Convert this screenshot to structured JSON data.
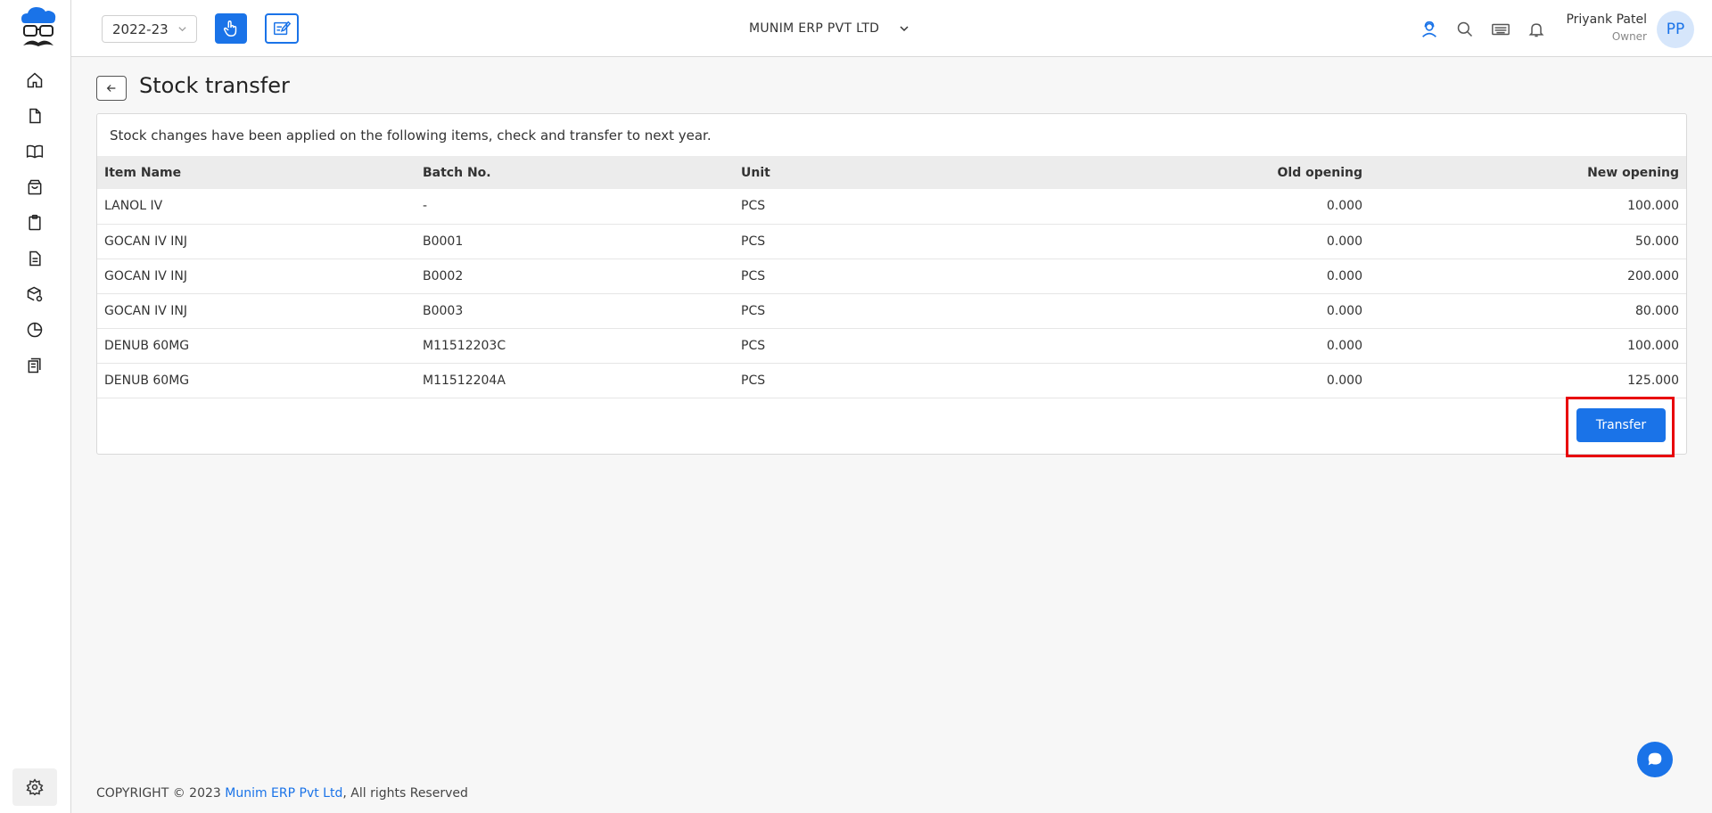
{
  "header": {
    "financial_year": "2022-23",
    "company": "MUNIM ERP PVT LTD",
    "user_name": "Priyank Patel",
    "user_role": "Owner",
    "avatar_initials": "PP"
  },
  "sidebar": {
    "items": [
      {
        "icon": "home-icon"
      },
      {
        "icon": "document-icon"
      },
      {
        "icon": "book-icon"
      },
      {
        "icon": "shopping-bag-icon"
      },
      {
        "icon": "clipboard-icon"
      },
      {
        "icon": "invoice-icon"
      },
      {
        "icon": "box-settings-icon"
      },
      {
        "icon": "pie-chart-icon"
      },
      {
        "icon": "ledger-icon"
      }
    ],
    "settings_icon": "gear-icon"
  },
  "page": {
    "title": "Stock transfer",
    "message": "Stock changes have been applied on the following items, check and transfer to next year."
  },
  "table": {
    "headers": [
      "Item Name",
      "Batch No.",
      "Unit",
      "Old opening",
      "New opening"
    ],
    "rows": [
      [
        "LANOL IV",
        "-",
        "PCS",
        "0.000",
        "100.000"
      ],
      [
        "GOCAN IV INJ",
        "B0001",
        "PCS",
        "0.000",
        "50.000"
      ],
      [
        "GOCAN IV INJ",
        "B0002",
        "PCS",
        "0.000",
        "200.000"
      ],
      [
        "GOCAN IV INJ",
        "B0003",
        "PCS",
        "0.000",
        "80.000"
      ],
      [
        "DENUB 60MG",
        "M11512203C",
        "PCS",
        "0.000",
        "100.000"
      ],
      [
        "DENUB 60MG",
        "M11512204A",
        "PCS",
        "0.000",
        "125.000"
      ]
    ]
  },
  "actions": {
    "transfer_label": "Transfer"
  },
  "footer": {
    "prefix": "COPYRIGHT © 2023 ",
    "company_link": "Munim ERP Pvt Ltd",
    "suffix": ", All rights Reserved"
  },
  "colors": {
    "accent": "#1a73e8",
    "highlight": "#e8000b"
  }
}
